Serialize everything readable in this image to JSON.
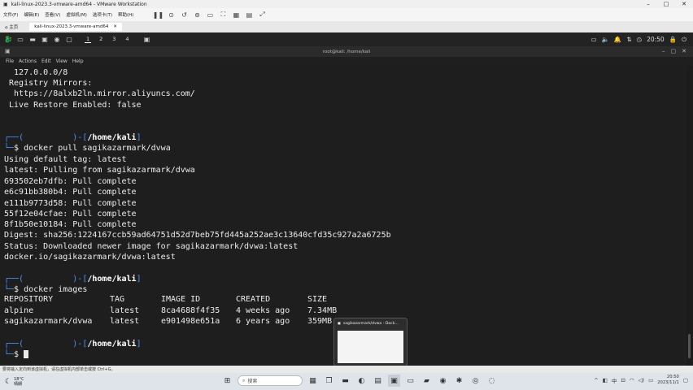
{
  "vmware": {
    "title": "kali-linux-2023.3-vmware-amd64 - VMware Workstation",
    "menu": [
      "文件(F)",
      "编辑(E)",
      "查看(V)",
      "虚拟机(M)",
      "选项卡(T)",
      "帮助(H)"
    ],
    "home_tab": "主页",
    "vm_tab": "kali-linux-2023.3-vmware-amd64"
  },
  "kali_panel": {
    "workspaces": [
      "1",
      "2",
      "3",
      "4"
    ],
    "active_workspace": "1",
    "time": "20:50"
  },
  "terminal": {
    "window_title": "root@kali: /home/kali",
    "menu": [
      "File",
      "Actions",
      "Edit",
      "View",
      "Help"
    ],
    "lines": {
      "l1": "  127.0.0.0/8",
      "l2": " Registry Mirrors:",
      "l3": "  https://8alxb2ln.mirror.aliyuncs.com/",
      "l4": " Live Restore Enabled: false",
      "p1_path": "/home/kali",
      "p1_cmd": "docker pull sagikazarmark/dvwa",
      "o1": "Using default tag: latest",
      "o2": "latest: Pulling from sagikazarmark/dvwa",
      "o3": "693502eb7dfb: Pull complete",
      "o4": "e6c91bb380b4: Pull complete",
      "o5": "e111b9773d58: Pull complete",
      "o6": "55f12e04cfae: Pull complete",
      "o7": "8f1b50e10184: Pull complete",
      "o8": "Digest: sha256:1224167ccb59ad64751d52d7beb75fd445a252ae3c13640cfd35c927a2a6725b",
      "o9": "Status: Downloaded newer image for sagikazarmark/dvwa:latest",
      "o10": "docker.io/sagikazarmark/dvwa:latest",
      "p2_path": "/home/kali",
      "p2_cmd": "docker images",
      "p3_path": "/home/kali"
    },
    "images_table": {
      "headers": [
        "REPOSITORY",
        "TAG",
        "IMAGE ID",
        "CREATED",
        "SIZE"
      ],
      "rows": [
        [
          "alpine",
          "latest",
          "8ca4688f4f35",
          "4 weeks ago",
          "7.34MB"
        ],
        [
          "sagikazarmark/dvwa",
          "latest",
          "e901498e651a",
          "6 years ago",
          "359MB"
        ]
      ]
    }
  },
  "thumbnail": {
    "title": "sagikazarmark/dvwa - Dock..."
  },
  "hint_bar": {
    "text": "要将输入定向到该虚拟机，请在虚拟机内部单击或按 Ctrl+G。"
  },
  "windows_taskbar": {
    "weather_temp": "18°C",
    "weather_desc": "晴朗",
    "search_placeholder": "搜索",
    "time": "20:50",
    "date": "2023/11/1",
    "lang": "中"
  }
}
